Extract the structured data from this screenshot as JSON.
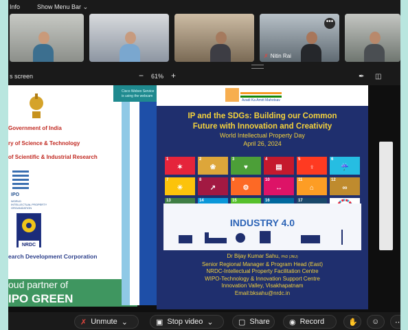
{
  "topbar": {
    "info": "Info",
    "show_menu_bar": "Show Menu Bar"
  },
  "participants": [
    {
      "name": ""
    },
    {
      "name": ""
    },
    {
      "name": ""
    },
    {
      "name": "Nitin Rai"
    },
    {
      "name": ""
    }
  ],
  "share": {
    "label": "s screen",
    "zoom": "61%"
  },
  "left_document": {
    "govt": "Government of India",
    "ministry": "ry of Science & Technology",
    "dept": "of Scientific & Industrial Research",
    "wipo": "IPO",
    "wipo_sub": [
      "WORLD",
      "INTELLECTUAL PROPERTY",
      "ORGANIZATION"
    ],
    "corporation": "earch Development Corporation",
    "partner_line1": "oud partner of",
    "partner_line2": "IPO GREEN"
  },
  "notification": {
    "line1": "Cisco Webex Service",
    "line2": "is using the webcam"
  },
  "poster": {
    "logo": "Azadi Ka Amrit Mahotsav",
    "title_line1": "IP and the SDGs: Building our Common",
    "title_line2": "Future with Innovation and Creativity",
    "subtitle": "World Intellectual Property Day",
    "date": "April 26, 2024",
    "industry": "INDUSTRY 4.0",
    "speaker": "Dr Bijay Kumar Sahu,",
    "speaker_suffix": "PhD (JNU)",
    "lines": [
      "Senior Regional Manager & Program Head (East)",
      "NRDC-Intellectual Property Facilitation Centre",
      "WIPO-Technology & Innovation Support Centre",
      "Innovation Valley, Visakhapatnam",
      "Email:bksahu@nrdc.in"
    ]
  },
  "toolbar": {
    "unmute": "Unmute",
    "stop_video": "Stop video",
    "share": "Share",
    "record": "Record"
  },
  "colors": {
    "sdg": [
      "#e5243b",
      "#dda63a",
      "#4c9f38",
      "#c5192d",
      "#ff3a21",
      "#26bde2",
      "#fcc30b",
      "#a21942",
      "#fd6925",
      "#dd1367",
      "#fd9d24",
      "#bf8b2e",
      "#3f7e44",
      "#0a97d9",
      "#56c02b",
      "#00689d",
      "#19486a"
    ]
  }
}
